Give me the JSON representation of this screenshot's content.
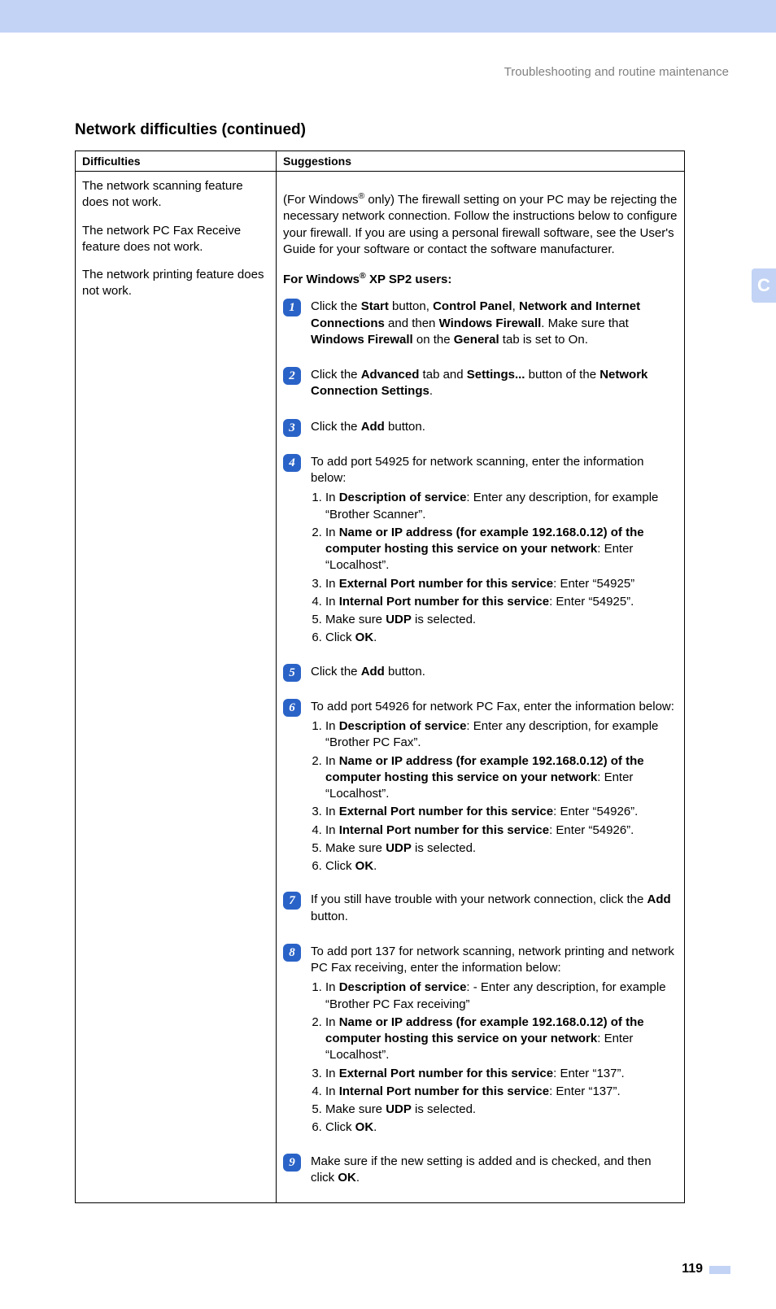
{
  "header": {
    "running_head": "Troubleshooting and routine maintenance"
  },
  "side_tab": "C",
  "section": {
    "title": "Network difficulties (continued)"
  },
  "table": {
    "headers": {
      "col1": "Difficulties",
      "col2": "Suggestions"
    },
    "left": {
      "p1": "The network scanning feature does not work.",
      "p2": "The network PC Fax Receive feature does not work.",
      "p3": "The network printing feature does not work."
    },
    "right": {
      "intro_pre": "(For Windows",
      "intro_sup": "®",
      "intro_post": " only) The firewall setting on your PC may be rejecting the necessary network connection. Follow the instructions below to configure your firewall. If you are using a personal firewall software, see the User's Guide for your software or contact the software manufacturer.",
      "subhead_pre": "For Windows",
      "subhead_sup": "®",
      "subhead_post": " XP SP2 users:",
      "steps": [
        {
          "num": "1",
          "parts": [
            "Click the ",
            "Start",
            " button, ",
            "Control Panel",
            ", ",
            "Network and Internet Connections",
            " and then ",
            "Windows Firewall",
            ". Make sure that ",
            "Windows Firewall",
            " on the ",
            "General",
            " tab is set to On."
          ]
        },
        {
          "num": "2",
          "parts": [
            "Click the ",
            "Advanced",
            " tab and ",
            "Settings...",
            " button of the ",
            "Network Connection Settings",
            "."
          ]
        },
        {
          "num": "3",
          "parts": [
            "Click the ",
            "Add",
            " button."
          ]
        },
        {
          "num": "4",
          "intro": "To add port 54925 for network scanning, enter the information below:",
          "list": [
            {
              "parts": [
                "In ",
                "Description of service",
                ": Enter any description, for example “Brother Scanner”."
              ]
            },
            {
              "parts": [
                "In ",
                "Name or IP address (for example 192.168.0.12) of the computer hosting this service on your network",
                ": Enter “Localhost”."
              ]
            },
            {
              "parts": [
                "In ",
                "External Port number for this service",
                ": Enter “54925”"
              ]
            },
            {
              "parts": [
                "In ",
                "Internal Port number for this service",
                ": Enter “54925”."
              ]
            },
            {
              "parts": [
                "Make sure ",
                "UDP",
                " is selected."
              ]
            },
            {
              "parts": [
                "Click ",
                "OK",
                "."
              ]
            }
          ]
        },
        {
          "num": "5",
          "parts": [
            "Click the ",
            "Add",
            " button."
          ]
        },
        {
          "num": "6",
          "intro": "To add port 54926 for network PC Fax, enter the information below:",
          "list": [
            {
              "parts": [
                "In ",
                "Description of service",
                ": Enter any description, for example “Brother PC Fax”."
              ]
            },
            {
              "parts": [
                "In ",
                "Name or IP address (for example 192.168.0.12) of the computer hosting this service on your network",
                ": Enter “Localhost”."
              ]
            },
            {
              "parts": [
                "In ",
                "External Port number for this service",
                ": Enter “54926”."
              ]
            },
            {
              "parts": [
                "In ",
                "Internal Port number for this service",
                ": Enter “54926”."
              ]
            },
            {
              "parts": [
                "Make sure ",
                "UDP",
                " is selected."
              ]
            },
            {
              "parts": [
                "Click ",
                "OK",
                "."
              ]
            }
          ]
        },
        {
          "num": "7",
          "parts": [
            "If you still have trouble with your network connection, click the ",
            "Add",
            " button."
          ]
        },
        {
          "num": "8",
          "intro": "To add port 137 for network scanning, network printing and network PC Fax receiving, enter the information below:",
          "list": [
            {
              "parts": [
                "In ",
                "Description of service",
                ": - Enter any description, for example “Brother PC Fax receiving”"
              ]
            },
            {
              "parts": [
                "In ",
                "Name or IP address (for example 192.168.0.12) of the computer hosting this service on your network",
                ": Enter “Localhost”."
              ]
            },
            {
              "parts": [
                "In ",
                "External Port number for this service",
                ": Enter “137”."
              ]
            },
            {
              "parts": [
                "In ",
                "Internal Port number for this service",
                ": Enter “137”."
              ]
            },
            {
              "parts": [
                "Make sure ",
                "UDP",
                " is selected."
              ]
            },
            {
              "parts": [
                "Click ",
                "OK",
                "."
              ]
            }
          ]
        },
        {
          "num": "9",
          "parts": [
            "Make sure if the new setting is added and is checked, and then click ",
            "OK",
            "."
          ]
        }
      ]
    }
  },
  "footer": {
    "page_number": "119"
  }
}
